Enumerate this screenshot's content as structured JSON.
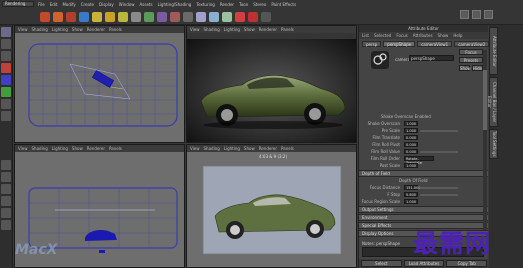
{
  "mode_select": "Rendering",
  "menu": [
    "File",
    "Edit",
    "Modify",
    "Create",
    "Display",
    "Window",
    "Assets",
    "Lighting/Shading",
    "Texturing",
    "Render",
    "Toon",
    "Stereo",
    "Paint Effects",
    "Fluid Effects",
    "Fur",
    "Hair",
    "Muscle",
    "Help"
  ],
  "viewport_menu": [
    "View",
    "Shading",
    "Lighting",
    "Show",
    "Renderer",
    "Panels"
  ],
  "viewports": {
    "top_left": {
      "label": ""
    },
    "top_right": {
      "label": ""
    },
    "bottom_left": {
      "label": ""
    },
    "bottom_right": {
      "label": "4:03 & 9 (3:2)"
    }
  },
  "attribute_editor": {
    "title": "Attribute Editor",
    "menu": [
      "List",
      "Selected",
      "Focus",
      "Attributes",
      "Show",
      "Help"
    ],
    "tabs": [
      "persp",
      "perspShape",
      "cameraView1",
      "cameraView2"
    ],
    "camera_label": "camera:",
    "camera_value": "perspShape",
    "focus_btn": "Focus",
    "presets_btn": "Presets",
    "show_btn": "Show",
    "hide_btn": "Hide",
    "rows": [
      {
        "label": "Shake Overscan Enabled",
        "value": ""
      },
      {
        "label": "Shake Overscan",
        "value": "1.000"
      },
      {
        "label": "Pre Scale",
        "value": "1.000"
      },
      {
        "label": "Film Translate",
        "value": "0.000"
      },
      {
        "label": "Film Roll Pivot",
        "value": "0.000"
      },
      {
        "label": "Film Roll Value",
        "value": "0.000"
      },
      {
        "label": "Film Roll Order",
        "value": "Rotate-Translate"
      },
      {
        "label": "Post Scale",
        "value": "1.000"
      }
    ],
    "dof_section": "Depth of Field",
    "dof_rows": [
      {
        "label": "Depth Of Field",
        "value": ""
      },
      {
        "label": "Focus Distance",
        "value": "151.000"
      },
      {
        "label": "F Stop",
        "value": "5.600"
      },
      {
        "label": "Focus Region Scale",
        "value": "1.000"
      }
    ],
    "sections": [
      "Output Settings",
      "Environment",
      "Special Effects",
      "Display Options",
      "Movement Options",
      "Orthographic Views"
    ],
    "notes_label": "Notes: perspShape",
    "bottom": [
      "Select",
      "Load Attributes",
      "Copy Tab"
    ]
  },
  "right_tabs": [
    "Attribute Editor",
    "Channel Box / Layer Editor",
    "Tool Settings"
  ],
  "logo": "MacX",
  "watermark": "最需网",
  "colors": {
    "viewport_bg": "#6f6f6f",
    "render_bg": "#1a1a1a",
    "watermark": "#4b23b0",
    "grid": "#3c3cb0"
  }
}
